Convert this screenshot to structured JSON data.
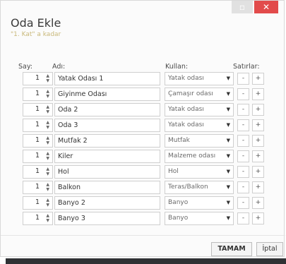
{
  "window": {
    "minimize_glyph": "▫",
    "close_glyph": "✕"
  },
  "header": {
    "title": "Oda Ekle",
    "subtitle": "\"1. Kat\" a kadar"
  },
  "columns": {
    "count": "Say:",
    "name": "Adı:",
    "use": "Kullan:",
    "rows": "Satırlar:"
  },
  "rows": [
    {
      "count": "1",
      "name": "Yatak Odası 1",
      "use": "Yatak odası"
    },
    {
      "count": "1",
      "name": "Giyinme Odası",
      "use": "Çamaşır odası"
    },
    {
      "count": "1",
      "name": "Oda 2",
      "use": "Yatak odası"
    },
    {
      "count": "1",
      "name": "Oda 3",
      "use": "Yatak odası"
    },
    {
      "count": "1",
      "name": "Mutfak 2",
      "use": "Mutfak"
    },
    {
      "count": "1",
      "name": "Kiler",
      "use": "Malzeme odası"
    },
    {
      "count": "1",
      "name": "Hol",
      "use": "Hol"
    },
    {
      "count": "1",
      "name": "Balkon",
      "use": "Teras/Balkon"
    },
    {
      "count": "1",
      "name": "Banyo 2",
      "use": "Banyo"
    },
    {
      "count": "1",
      "name": "Banyo 3",
      "use": "Banyo"
    }
  ],
  "controls": {
    "spin_up": "▲",
    "spin_down": "▼",
    "dropdown": "▼",
    "remove": "-",
    "add": "+"
  },
  "footer": {
    "ok_label": "TAMAM",
    "cancel_label": "İptal"
  },
  "colors": {
    "accent_close": "#e24b4b",
    "subtitle": "#c9b87a"
  }
}
